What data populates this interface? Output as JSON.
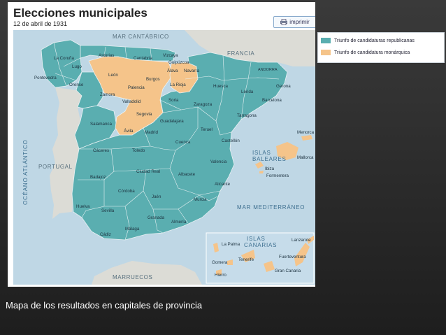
{
  "header": {
    "title": "Elecciones municipales",
    "date": "12 de abril de 1931",
    "print_label": "imprimir"
  },
  "legend": [
    {
      "label": "Triunfo de candidaturas republicanas",
      "color": "#5aaeb0"
    },
    {
      "label": "Triunfo de candidatura monárquica",
      "color": "#f5c48a"
    }
  ],
  "colors": {
    "republican": "#5aaeb0",
    "monarchist": "#f5c48a",
    "sea": "#bfd7e5",
    "neighbour_land": "#dcdcd6"
  },
  "map": {
    "regions": {
      "mar_cantabrico": "MAR CANTÁBRICO",
      "francia": "FRANCIA",
      "andorra": "ANDORRA",
      "portugal": "PORTUGAL",
      "oceano_atlantico": "OCÉANO ATLÁNTICO",
      "islas_baleares_1": "ISLAS",
      "islas_baleares_2": "BALEARES",
      "mar_mediterraneo": "MAR MEDITERRÁNEO",
      "marruecos": "MARRUECOS",
      "islas_canarias_1": "ISLAS",
      "islas_canarias_2": "CANARIAS"
    },
    "provinces": [
      {
        "name": "La Coruña",
        "result": "republican"
      },
      {
        "name": "Lugo",
        "result": "republican"
      },
      {
        "name": "Pontevedra",
        "result": "republican"
      },
      {
        "name": "Orense",
        "result": "republican"
      },
      {
        "name": "Asturias",
        "result": "republican"
      },
      {
        "name": "Cantabria",
        "result": "republican"
      },
      {
        "name": "Vizcaya",
        "result": "republican"
      },
      {
        "name": "Guipúzcoa",
        "result": "republican"
      },
      {
        "name": "Álava",
        "result": "monarchist"
      },
      {
        "name": "Navarra",
        "result": "monarchist"
      },
      {
        "name": "León",
        "result": "monarchist"
      },
      {
        "name": "Burgos",
        "result": "monarchist"
      },
      {
        "name": "Palencia",
        "result": "monarchist"
      },
      {
        "name": "La Rioja",
        "result": "monarchist"
      },
      {
        "name": "Huesca",
        "result": "republican"
      },
      {
        "name": "Lérida",
        "result": "republican"
      },
      {
        "name": "Gerona",
        "result": "republican"
      },
      {
        "name": "Barcelona",
        "result": "republican"
      },
      {
        "name": "Zamora",
        "result": "republican"
      },
      {
        "name": "Valladolid",
        "result": "monarchist"
      },
      {
        "name": "Soria",
        "result": "monarchist"
      },
      {
        "name": "Zaragoza",
        "result": "republican"
      },
      {
        "name": "Tarragona",
        "result": "republican"
      },
      {
        "name": "Segovia",
        "result": "monarchist"
      },
      {
        "name": "Salamanca",
        "result": "republican"
      },
      {
        "name": "Ávila",
        "result": "monarchist"
      },
      {
        "name": "Madrid",
        "result": "republican"
      },
      {
        "name": "Guadalajara",
        "result": "republican"
      },
      {
        "name": "Teruel",
        "result": "republican"
      },
      {
        "name": "Castellón",
        "result": "republican"
      },
      {
        "name": "Cuenca",
        "result": "republican"
      },
      {
        "name": "Cáceres",
        "result": "republican"
      },
      {
        "name": "Toledo",
        "result": "republican"
      },
      {
        "name": "Valencia",
        "result": "republican"
      },
      {
        "name": "Badajoz",
        "result": "republican"
      },
      {
        "name": "Ciudad Real",
        "result": "republican"
      },
      {
        "name": "Albacete",
        "result": "republican"
      },
      {
        "name": "Alicante",
        "result": "republican"
      },
      {
        "name": "Córdoba",
        "result": "republican"
      },
      {
        "name": "Jaén",
        "result": "republican"
      },
      {
        "name": "Murcia",
        "result": "republican"
      },
      {
        "name": "Huelva",
        "result": "republican"
      },
      {
        "name": "Sevilla",
        "result": "republican"
      },
      {
        "name": "Granada",
        "result": "republican"
      },
      {
        "name": "Almería",
        "result": "republican"
      },
      {
        "name": "Cádiz",
        "result": "republican"
      },
      {
        "name": "Málaga",
        "result": "republican"
      },
      {
        "name": "Menorca",
        "result": "monarchist"
      },
      {
        "name": "Mallorca",
        "result": "monarchist"
      },
      {
        "name": "Ibiza",
        "result": "monarchist"
      },
      {
        "name": "Formentera",
        "result": "monarchist"
      },
      {
        "name": "La Palma",
        "result": "monarchist"
      },
      {
        "name": "Lanzarote",
        "result": "monarchist"
      },
      {
        "name": "Fuerteventura",
        "result": "monarchist"
      },
      {
        "name": "Gomera",
        "result": "monarchist"
      },
      {
        "name": "Tenerife",
        "result": "monarchist"
      },
      {
        "name": "Gran Canaria",
        "result": "monarchist"
      },
      {
        "name": "Hierro",
        "result": "monarchist"
      }
    ]
  },
  "caption": "Mapa de los resultados en capitales de provincia"
}
